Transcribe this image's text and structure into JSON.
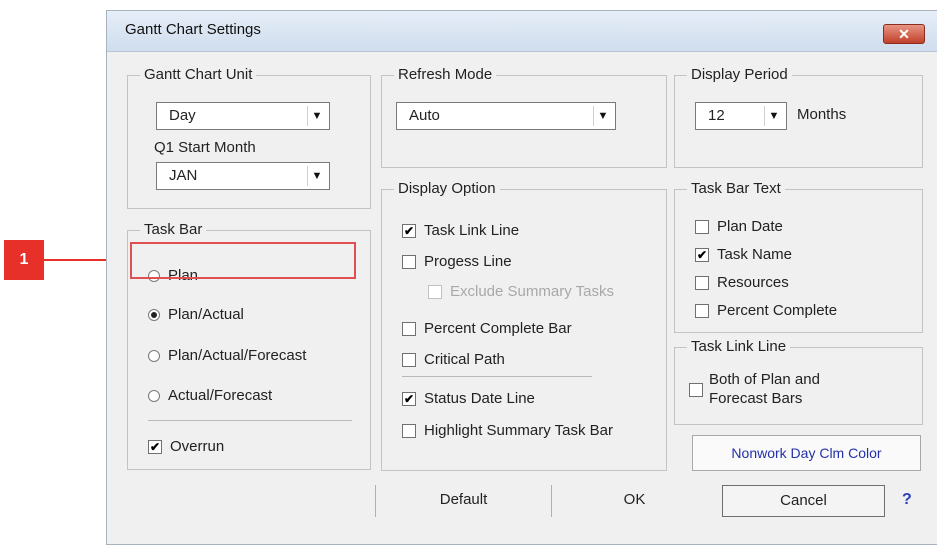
{
  "dialog": {
    "title": "Gantt Chart Settings",
    "close_glyph": "✕"
  },
  "gantt_unit": {
    "title": "Gantt Chart Unit",
    "unit_value": "Day",
    "q1_label": "Q1 Start Month",
    "q1_value": "JAN"
  },
  "refresh": {
    "title": "Refresh Mode",
    "value": "Auto"
  },
  "display_period": {
    "title": "Display Period",
    "value": "12",
    "unit": "Months"
  },
  "task_bar": {
    "title": "Task Bar",
    "options": [
      "Plan",
      "Plan/Actual",
      "Plan/Actual/Forecast",
      "Actual/Forecast"
    ],
    "selected": "Plan/Actual",
    "overrun_label": "Overrun",
    "overrun_checked": true
  },
  "display_option": {
    "title": "Display Option",
    "items": [
      {
        "label": "Task Link Line",
        "checked": true
      },
      {
        "label": "Progess Line",
        "checked": false
      },
      {
        "label": "Exclude Summary Tasks",
        "checked": false,
        "disabled": true
      },
      {
        "label": "Percent Complete Bar",
        "checked": false
      },
      {
        "label": "Critical Path",
        "checked": false
      },
      {
        "label": "Status Date Line",
        "checked": true
      },
      {
        "label": "Highlight Summary Task Bar",
        "checked": false
      }
    ]
  },
  "task_bar_text": {
    "title": "Task Bar Text",
    "items": [
      {
        "label": "Plan Date",
        "checked": false
      },
      {
        "label": "Task Name",
        "checked": true
      },
      {
        "label": "Resources",
        "checked": false
      },
      {
        "label": "Percent Complete",
        "checked": false
      }
    ]
  },
  "task_link_line": {
    "title": "Task Link Line",
    "option_line1": "Both of Plan and",
    "option_line2": "Forecast Bars",
    "checked": false
  },
  "buttons": {
    "nonwork": "Nonwork Day Clm Color",
    "default": "Default",
    "ok": "OK",
    "cancel": "Cancel",
    "help": "?"
  },
  "callout": {
    "number": "1",
    "color": "#e8302a"
  },
  "icons": {
    "dropdown": "▼",
    "check": "✔"
  }
}
